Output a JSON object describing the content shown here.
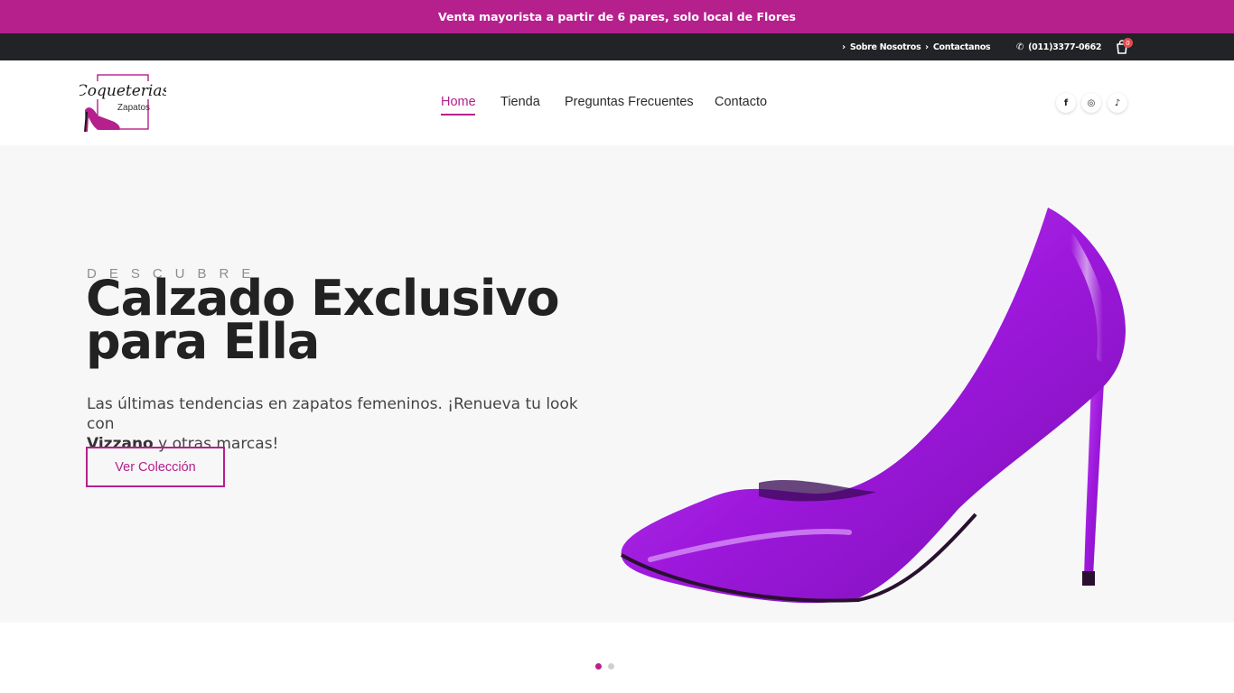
{
  "promo": {
    "text": "Venta mayorista a partir de 6 pares, solo local de Flores"
  },
  "topbar": {
    "links": [
      {
        "label": "Sobre Nosotros"
      },
      {
        "label": "Contactanos"
      }
    ],
    "phone": "(011)3377-0662",
    "cart_count": "0"
  },
  "logo": {
    "script": "Coqueterias",
    "sub": "Zapatos"
  },
  "nav": {
    "items": [
      {
        "label": "Home",
        "active": true
      },
      {
        "label": "Tienda"
      },
      {
        "label": "Preguntas Frecuentes"
      },
      {
        "label": "Contacto"
      }
    ]
  },
  "social": [
    {
      "icon": "facebook-icon",
      "glyph": "f"
    },
    {
      "icon": "instagram-icon",
      "glyph": "◎"
    },
    {
      "icon": "tiktok-icon",
      "glyph": "♪"
    }
  ],
  "hero": {
    "eyebrow": "DESCUBRE",
    "headline_line1": "Calzado Exclusivo",
    "headline_line2": "para Ella",
    "subtitle_part1": "Las últimas tendencias en zapatos femeninos. ¡Renueva tu look con",
    "subtitle_brand": "Vizzano",
    "subtitle_part2": "y otras marcas!",
    "cta": "Ver Colección"
  },
  "carousel": {
    "slide_count": 2,
    "active_index": 0
  },
  "colors": {
    "brand": "#b5208c",
    "topbar": "#222326",
    "hero_bg": "#f7f7f7",
    "shoe": "#a21ee0",
    "badge": "#e5484d"
  }
}
